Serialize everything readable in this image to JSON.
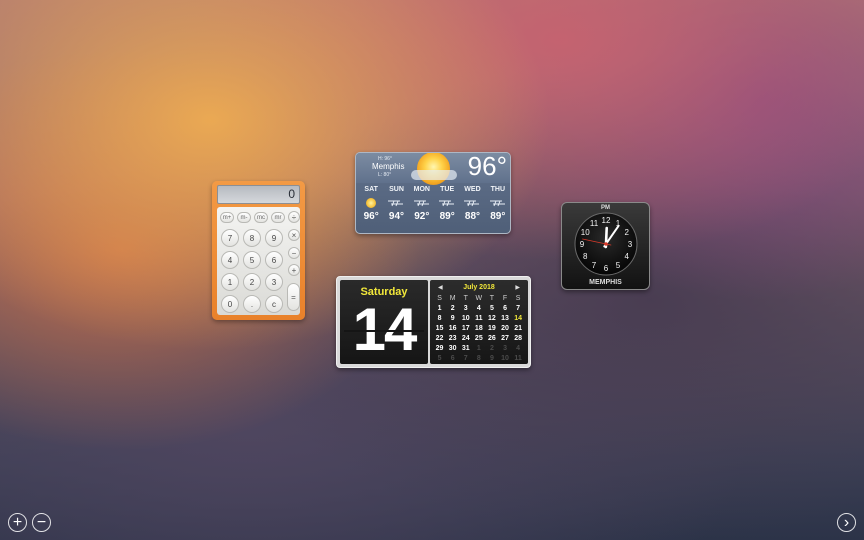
{
  "calculator": {
    "display": "0",
    "memory_buttons": [
      "m+",
      "m-",
      "mc",
      "mr"
    ],
    "divide": "÷",
    "rows": [
      [
        "7",
        "8",
        "9"
      ],
      [
        "4",
        "5",
        "6"
      ],
      [
        "1",
        "2",
        "3"
      ],
      [
        "0",
        ".",
        "c"
      ]
    ],
    "ops": [
      "×",
      "−",
      "+"
    ],
    "equals": "="
  },
  "weather": {
    "hi": "H: 96°",
    "city": "Memphis",
    "lo": "L: 80°",
    "current_temp": "96°",
    "forecast": [
      {
        "day": "SAT",
        "hi": "96°",
        "icon": "sun-icon"
      },
      {
        "day": "SUN",
        "hi": "94°",
        "icon": "wind-icon"
      },
      {
        "day": "MON",
        "hi": "92°",
        "icon": "wind-icon"
      },
      {
        "day": "TUE",
        "hi": "89°",
        "icon": "wind-icon"
      },
      {
        "day": "WED",
        "hi": "88°",
        "icon": "wind-icon"
      },
      {
        "day": "THU",
        "hi": "89°",
        "icon": "wind-icon"
      }
    ]
  },
  "calendar": {
    "weekday": "Saturday",
    "date": "14",
    "month_label": "July 2018",
    "prev": "◀",
    "next": "▶",
    "dow": [
      "S",
      "M",
      "T",
      "W",
      "T",
      "F",
      "S"
    ],
    "weeks": [
      [
        "1",
        "2",
        "3",
        "4",
        "5",
        "6",
        "7"
      ],
      [
        "8",
        "9",
        "10",
        "11",
        "12",
        "13",
        "14"
      ],
      [
        "15",
        "16",
        "17",
        "18",
        "19",
        "20",
        "21"
      ],
      [
        "22",
        "23",
        "24",
        "25",
        "26",
        "27",
        "28"
      ],
      [
        "29",
        "30",
        "31",
        "1",
        "2",
        "3",
        "4"
      ],
      [
        "5",
        "6",
        "7",
        "8",
        "9",
        "10",
        "11"
      ]
    ],
    "today": "14"
  },
  "clock": {
    "ampm": "PM",
    "city": "MEMPHIS",
    "numerals": [
      "12",
      "1",
      "2",
      "3",
      "4",
      "5",
      "6",
      "7",
      "8",
      "9",
      "10",
      "11"
    ],
    "hour": 12,
    "minute": 5,
    "second": 47
  },
  "controls": {
    "add": "+",
    "remove": "−",
    "next": "›"
  },
  "colors": {
    "calculator_orange": "#ee8a33",
    "calendar_yellow": "#f2e83a",
    "clock_second_hand": "#d83a2a"
  }
}
